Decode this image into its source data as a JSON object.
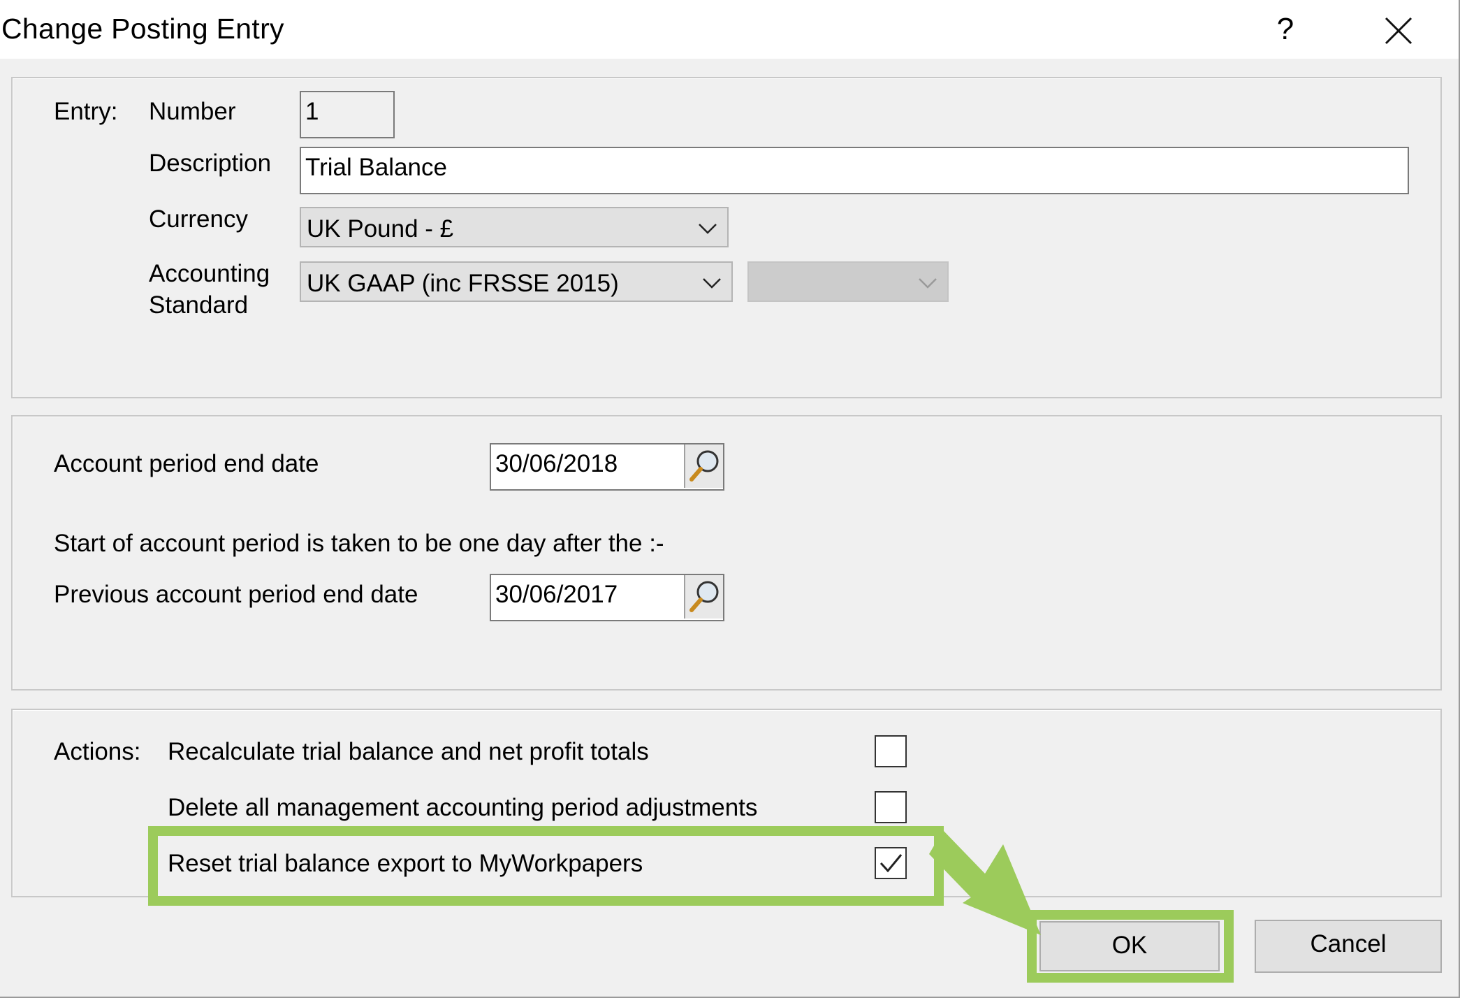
{
  "window": {
    "title": "Change Posting Entry",
    "help_label": "?"
  },
  "entry": {
    "section_label": "Entry:",
    "number_label": "Number",
    "number_value": "1",
    "description_label": "Description",
    "description_value": "Trial Balance",
    "currency_label": "Currency",
    "currency_value": "UK Pound - £",
    "standard_label_line1": "Accounting",
    "standard_label_line2": "Standard",
    "standard_value": "UK GAAP (inc FRSSE 2015)",
    "standard_secondary_value": ""
  },
  "period": {
    "end_date_label": "Account period end date",
    "end_date_value": "30/06/2018",
    "info_text": "Start of account period is taken to be one day after the :-",
    "prev_end_date_label": "Previous account period end date",
    "prev_end_date_value": "30/06/2017"
  },
  "actions": {
    "section_label": "Actions:",
    "items": [
      {
        "label": "Recalculate trial balance and net profit totals",
        "checked": false
      },
      {
        "label": "Delete all management accounting period adjustments",
        "checked": false
      },
      {
        "label": "Reset trial balance export to MyWorkpapers",
        "checked": true
      }
    ]
  },
  "buttons": {
    "ok": "OK",
    "cancel": "Cancel"
  },
  "colors": {
    "highlight": "#9ccb5b",
    "dialog_bg": "#f0f0f0"
  },
  "icons": {
    "help": "question-mark",
    "close": "close-x",
    "lookup": "magnifier-icon",
    "dropdown": "chevron-down-icon"
  }
}
